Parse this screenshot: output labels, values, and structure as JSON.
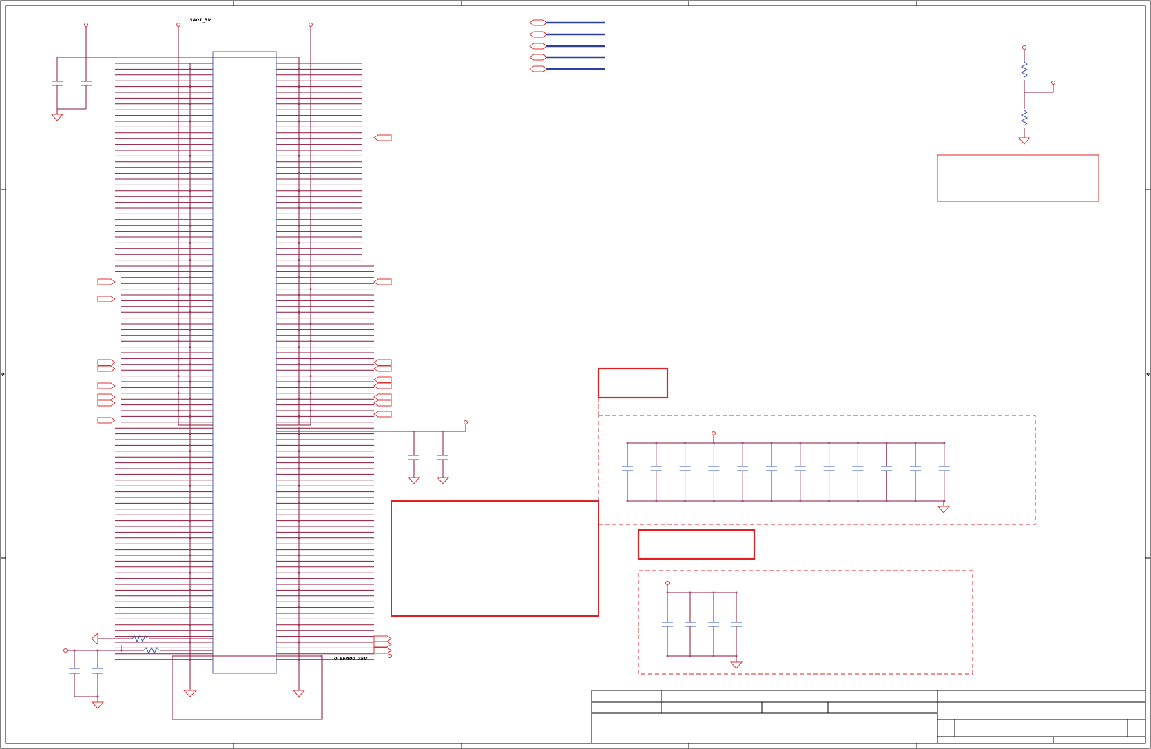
{
  "schematic": {
    "net_labels": {
      "rail_top": "3A01_5V",
      "rail_bottom": "0_65A00_75V"
    }
  },
  "colors": {
    "wire": "#8b1538",
    "component": "#e03030",
    "ic_body": "#4a5fa5",
    "bus": "#2b3fa0",
    "pin_dot": "#b04090",
    "passive": "#3050b0",
    "frame": "#000000",
    "annotation": "#e02020"
  }
}
